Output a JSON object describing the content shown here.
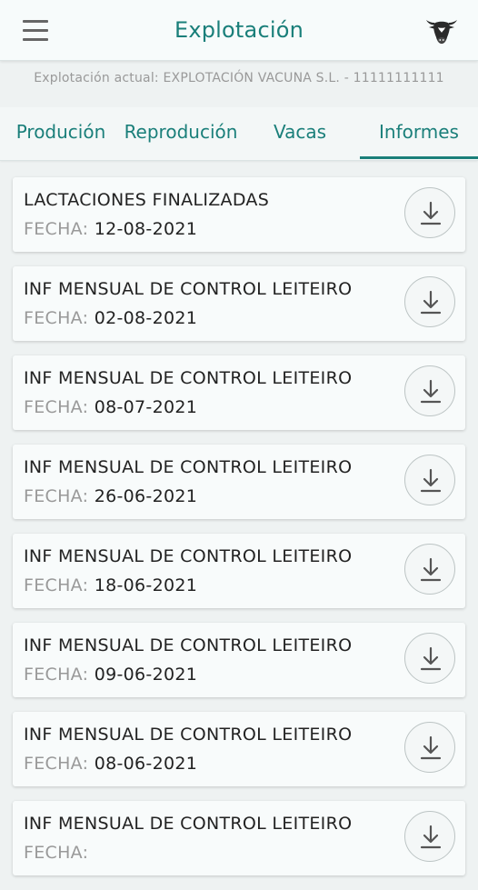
{
  "header": {
    "title": "Explotación",
    "menu_icon": "hamburger-menu-icon",
    "profile_icon": "cow-head-icon"
  },
  "farm": {
    "current_label": "Explotación actual: EXPLOTACIÓN VACUNA S.L. - 11111111111"
  },
  "tabs": [
    {
      "label": "Produción",
      "active": false
    },
    {
      "label": "Reprodución",
      "active": false
    },
    {
      "label": "Vacas",
      "active": false
    },
    {
      "label": "Informes",
      "active": true
    }
  ],
  "reports": [
    {
      "title": "LACTACIONES FINALIZADAS",
      "date_label": "FECHA:",
      "date": "12-08-2021"
    },
    {
      "title": "INF MENSUAL DE CONTROL LEITEIRO",
      "date_label": "FECHA:",
      "date": "02-08-2021"
    },
    {
      "title": "INF MENSUAL DE CONTROL LEITEIRO",
      "date_label": "FECHA:",
      "date": "08-07-2021"
    },
    {
      "title": "INF MENSUAL DE CONTROL LEITEIRO",
      "date_label": "FECHA:",
      "date": "26-06-2021"
    },
    {
      "title": "INF MENSUAL DE CONTROL LEITEIRO",
      "date_label": "FECHA:",
      "date": "18-06-2021"
    },
    {
      "title": "INF MENSUAL DE CONTROL LEITEIRO",
      "date_label": "FECHA:",
      "date": "09-06-2021"
    },
    {
      "title": "INF MENSUAL DE CONTROL LEITEIRO",
      "date_label": "FECHA:",
      "date": "08-06-2021"
    },
    {
      "title": "INF MENSUAL DE CONTROL LEITEIRO",
      "date_label": "FECHA:",
      "date": ""
    }
  ],
  "colors": {
    "accent": "#1a7f7a",
    "background": "#eef2f2",
    "card": "#f8fbfb",
    "muted_text": "#999999"
  }
}
